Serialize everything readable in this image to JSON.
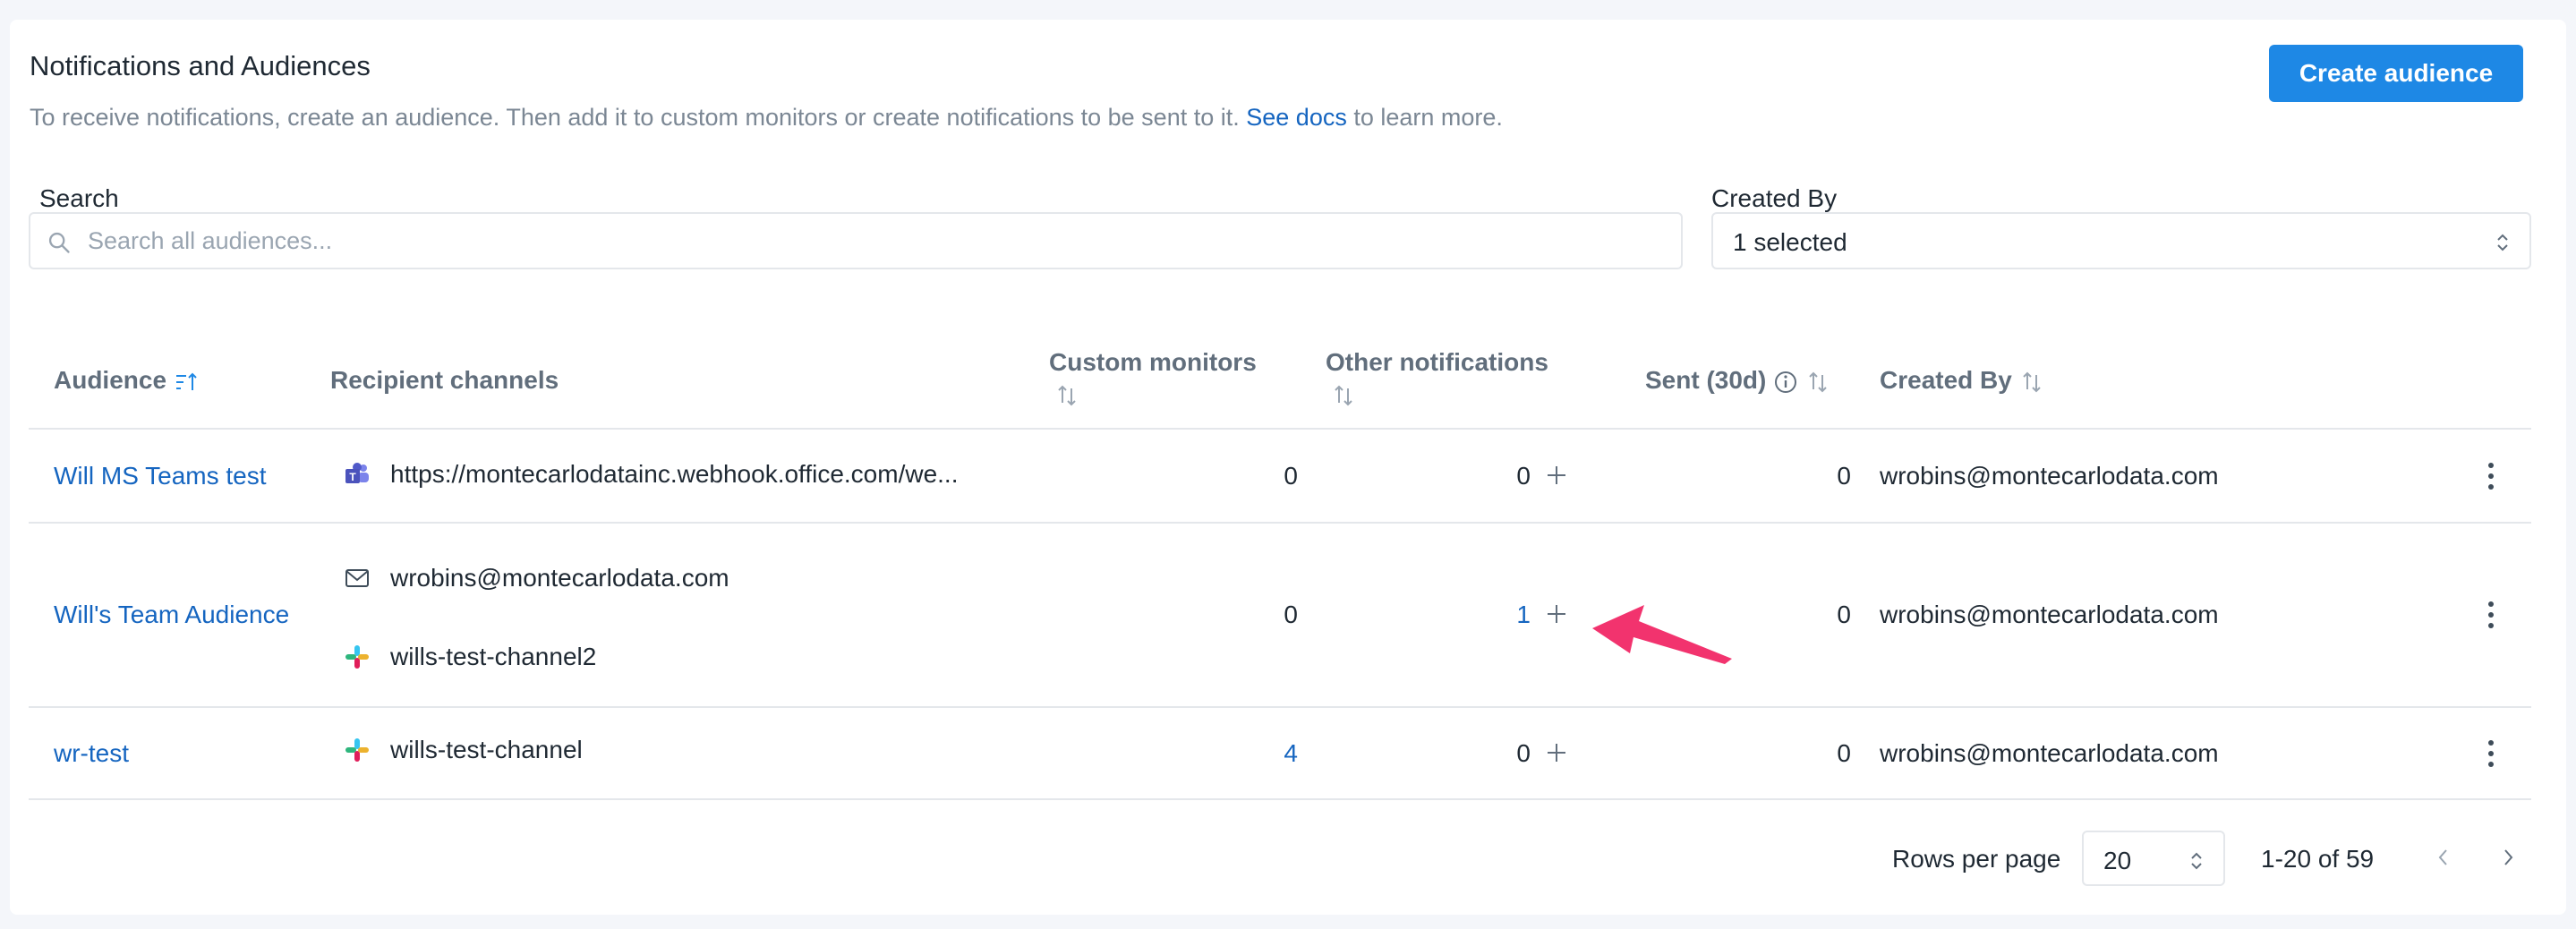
{
  "header": {
    "title": "Notifications and Audiences",
    "desc_before": "To receive notifications, create an audience. Then add it to custom monitors or create notifications to be sent to it.",
    "desc_link": "See docs",
    "desc_after": "to learn more.",
    "create_button": "Create audience"
  },
  "filters": {
    "search_label": "Search",
    "search_placeholder": "Search all audiences...",
    "created_by_label": "Created By",
    "created_by_value": "1 selected"
  },
  "table": {
    "columns": {
      "audience": "Audience",
      "recipient_channels": "Recipient channels",
      "custom_monitors": "Custom monitors",
      "other_notifications": "Other notifications",
      "sent": "Sent (30d)",
      "created_by": "Created By"
    },
    "rows": [
      {
        "audience": "Will MS Teams test",
        "channels": [
          {
            "type": "teams-icon",
            "label": "https://montecarlodatainc.webhook.office.com/we..."
          }
        ],
        "custom_monitors": "0",
        "other_notifications": "0",
        "sent": "0",
        "created_by": "wrobins@montecarlodata.com"
      },
      {
        "audience": "Will's Team Audience",
        "channels": [
          {
            "type": "mail-icon",
            "label": "wrobins@montecarlodata.com"
          },
          {
            "type": "slack-icon",
            "label": "wills-test-channel2"
          }
        ],
        "custom_monitors": "0",
        "other_notifications": "1",
        "sent": "0",
        "created_by": "wrobins@montecarlodata.com"
      },
      {
        "audience": "wr-test",
        "channels": [
          {
            "type": "slack-icon",
            "label": "wills-test-channel"
          }
        ],
        "custom_monitors": "4",
        "other_notifications": "0",
        "sent": "0",
        "created_by": "wrobins@montecarlodata.com"
      }
    ]
  },
  "pagination": {
    "rows_per_page_label": "Rows per page",
    "rows_per_page": "20",
    "range": "1-20 of 59"
  },
  "colors": {
    "accent": "#1e88e5",
    "link": "#1565c0",
    "annotation_arrow": "#f2336e"
  }
}
